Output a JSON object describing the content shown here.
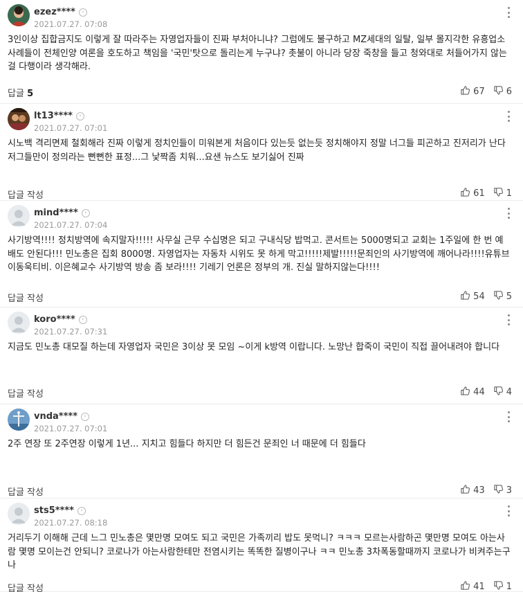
{
  "reply_write_label": "답글 작성",
  "reply_prefix": "답글",
  "info_glyph": "›",
  "comments": [
    {
      "nickname": "ezez****",
      "date": "2021.07.27. 07:08",
      "avatar": "photo",
      "text": "3인이상 집합금지도 이렇게 잘 따라주는 자영업자들이 진짜 부처아니냐? 그럼에도 불구하고 MZ세대의 일탈, 일부 몰지각한 유흥업소 사례들이 전체인양 여론을 호도하고 책임을 '국민'탓으로 돌리는게 누구냐? 촛불이 아니라 당장 죽창을 들고 청와대로 처들어가지 않는걸 다행이라 생각해라.",
      "reply_count": "5",
      "likes": "67",
      "dislikes": "6"
    },
    {
      "nickname": "lt13****",
      "date": "2021.07.27. 07:01",
      "avatar": "photo",
      "text": "시노백 격리면제 철회해라 진짜 이렇게 정치인들이 미워본게 처음이다 있는듯 없는듯 정치해야지 정말 너그들 피곤하고 진저리가 난다 저그들만이 정의라는 뻔뻔한 표정...그 낯짝좀 치워...요샌 뉴스도 보기싫어 진짜",
      "reply_count": "",
      "likes": "61",
      "dislikes": "1"
    },
    {
      "nickname": "mind****",
      "date": "2021.07.27. 07:04",
      "avatar": "default",
      "text": "사기방역!!!! 정치방역에 속지말자!!!!! 사무실 근무 수십명은 되고 구내식당 밥먹고. 콘서트는 5000명되고 교회는 1주일에 한 번 예배도 안된다!!! 민노총은 집회 8000명. 자영업자는 자동차 시위도 못 하게 막고!!!!!제발!!!!!문죄인의 사기방역에 깨어나라!!!!유튜브 이동욱티비. 이은혜교수 사기방역 방송 좀 보라!!!! 기레기 언론은 정부의 개. 진실 말하지않는다!!!!",
      "reply_count": "",
      "likes": "54",
      "dislikes": "5"
    },
    {
      "nickname": "koro****",
      "date": "2021.07.27. 07:31",
      "avatar": "default",
      "text": "지금도 민노총 대모질 하는데 자영업자 국민은 3이상 못 모임 ~이게 k방역 이랍니다. 노망난 합죽이 국민이 직접 끌어내려야 합니다",
      "reply_count": "",
      "likes": "44",
      "dislikes": "4"
    },
    {
      "nickname": "vnda****",
      "date": "2021.07.27. 07:01",
      "avatar": "photo",
      "text": "2주 연장 또 2주연장 이렇게 1년... 지치고 힘들다 하지만 더 힘든건 문죄인 너 때문에 더 힘들다",
      "reply_count": "",
      "likes": "43",
      "dislikes": "3"
    },
    {
      "nickname": "sts5****",
      "date": "2021.07.27. 08:18",
      "avatar": "default",
      "text": "거리두기 이해해 근데 느그 민노총은 몇만명 모여도 되고 국민은 가족끼리 밥도 못먹니? ㅋㅋㅋ 모르는사람하곤 몇만명 모여도 아는사람 몇명 모이는건 안되니? 코로나가 아는사람한테만 전염시키는 똑똑한 질병이구나 ㅋㅋ 민노총 3차폭동할때까지 코로나가 비켜주는구나",
      "reply_count": "",
      "likes": "41",
      "dislikes": "1"
    }
  ]
}
